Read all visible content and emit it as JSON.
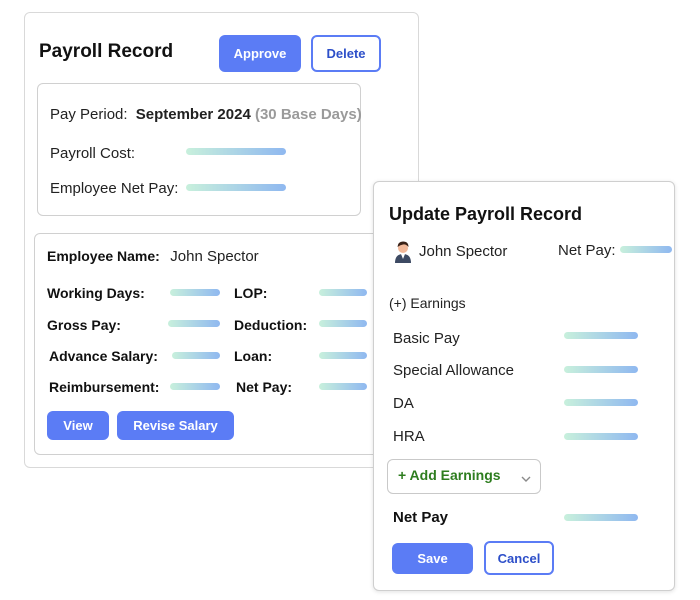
{
  "payroll_record": {
    "title": "Payroll Record",
    "approve_label": "Approve",
    "delete_label": "Delete",
    "pay_period_label": "Pay Period:",
    "pay_period_value": "September 2024",
    "base_days": "(30 Base Days)",
    "payroll_cost_label": "Payroll Cost:",
    "employee_net_pay_label": "Employee Net Pay:"
  },
  "employee": {
    "name_label": "Employee Name:",
    "name": "John Spector",
    "fields": {
      "working_days": "Working Days:",
      "lop": "LOP:",
      "gross_pay": "Gross Pay:",
      "deduction": "Deduction:",
      "advance_salary": "Advance Salary:",
      "loan": "Loan:",
      "reimbursement": "Reimbursement:",
      "net_pay": "Net Pay:"
    },
    "view_label": "View",
    "revise_label": "Revise Salary"
  },
  "update_panel": {
    "title": "Update Payroll Record",
    "employee_name": "John Spector",
    "net_pay_label": "Net Pay:",
    "earnings_header": "(+) Earnings",
    "earnings": [
      "Basic Pay",
      "Special Allowance",
      "DA",
      "HRA"
    ],
    "add_earnings_label": "+ Add Earnings",
    "net_pay_total_label": "Net Pay",
    "save_label": "Save",
    "cancel_label": "Cancel"
  },
  "colors": {
    "primary": "#5b7cf5",
    "green_text": "#2e7d1f",
    "muted": "#9a9a9a"
  },
  "icons": {
    "avatar": "person-avatar-icon",
    "dropdown": "chevron-down-icon"
  }
}
